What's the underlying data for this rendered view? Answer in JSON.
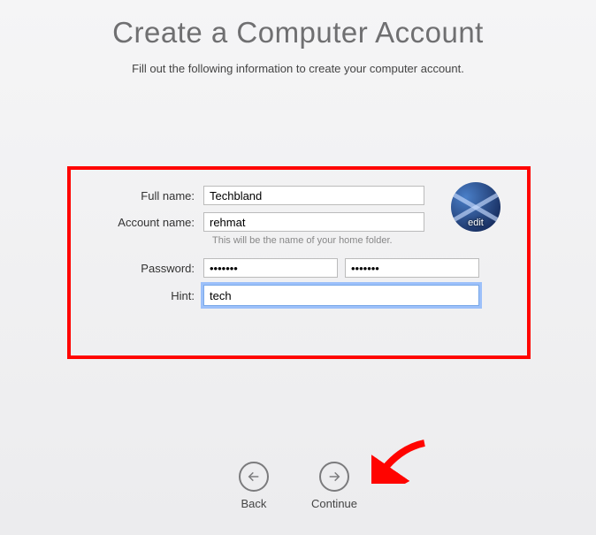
{
  "title": "Create a Computer Account",
  "subtitle": "Fill out the following information to create your computer account.",
  "form": {
    "fullname_label": "Full name:",
    "fullname_value": "Techbland",
    "accountname_label": "Account name:",
    "accountname_value": "rehmat",
    "accountname_helper": "This will be the name of your home folder.",
    "password_label": "Password:",
    "password_value": "•••••••",
    "password_verify_value": "•••••••",
    "hint_label": "Hint:",
    "hint_value": "tech"
  },
  "avatar": {
    "edit_label": "edit"
  },
  "nav": {
    "back_label": "Back",
    "continue_label": "Continue"
  }
}
